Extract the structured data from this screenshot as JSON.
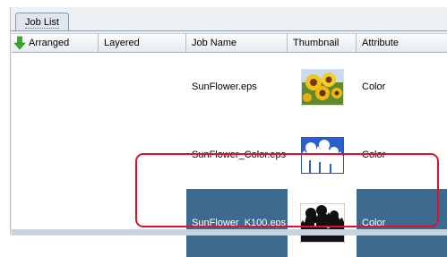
{
  "tab": {
    "label": "Job List"
  },
  "columns": [
    {
      "label": "Arranged",
      "sort_icon": "green-down-arrow-icon"
    },
    {
      "label": "Layered"
    },
    {
      "label": "Job Name"
    },
    {
      "label": "Thumbnail"
    },
    {
      "label": "Attribute"
    }
  ],
  "rows": [
    {
      "job_name": "SunFlower.eps",
      "thumbnail": "sunflower-color-thumbnail",
      "attribute": "Color",
      "selected": false
    },
    {
      "job_name": "SunFlower_Color.eps",
      "thumbnail": "sunflower-silhouette-blue-thumbnail",
      "attribute": "Color",
      "selected": false
    },
    {
      "job_name": "SunFlower_K100.eps",
      "thumbnail": "sunflower-black-silhouette-thumbnail",
      "attribute": "Color",
      "selected": true
    }
  ],
  "colors": {
    "selection": "#3d6b8f",
    "highlight": "#e0112c",
    "sort_arrow": "#3aa72d"
  }
}
